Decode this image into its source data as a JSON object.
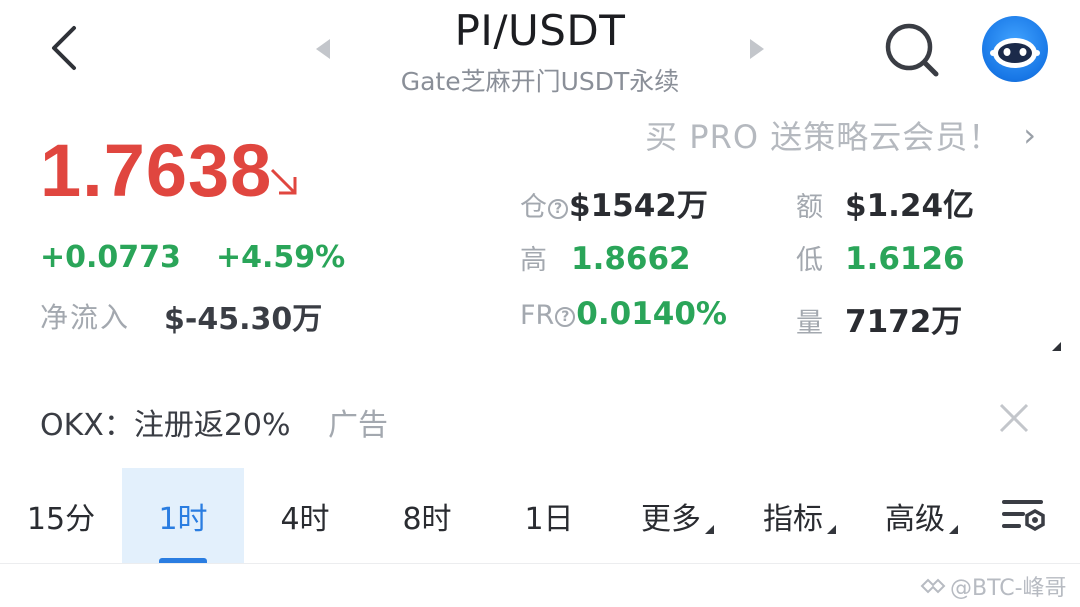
{
  "header": {
    "title": "PI/USDT",
    "subtitle": "Gate芝麻开门USDT永续"
  },
  "promo": {
    "text": "买 PRO 送策略云会员！",
    "chevron": "›"
  },
  "price": {
    "last": "1.7638",
    "change_abs": "+0.0773",
    "change_pct": "+4.59%",
    "netflow_label": "净流入",
    "netflow_value": "$-45.30万"
  },
  "stats": {
    "oi_label": "仓",
    "oi_value": "$1542万",
    "turnover_label": "额",
    "turnover_value": "$1.24亿",
    "high_label": "高",
    "high_value": "1.8662",
    "low_label": "低",
    "low_value": "1.6126",
    "fr_label": "FR",
    "fr_value": "0.0140%",
    "volume_label": "量",
    "volume_value": "7172万",
    "help_glyph": "?"
  },
  "ad": {
    "text": "OKX：注册返20%",
    "tag": "广告"
  },
  "tabs": [
    {
      "label": "15分"
    },
    {
      "label": "1时"
    },
    {
      "label": "4时"
    },
    {
      "label": "8时"
    },
    {
      "label": "1日"
    },
    {
      "label": "更多"
    },
    {
      "label": "指标"
    },
    {
      "label": "高级"
    }
  ],
  "watermark": "@BTC-峰哥",
  "colors": {
    "price_red": "#e0463f",
    "up_green": "#2aa559",
    "accent_blue": "#2a7de1",
    "active_tab_bg": "#e3f0fc"
  },
  "icons": [
    "back-arrow-icon",
    "triangle-left-icon",
    "triangle-right-icon",
    "search-icon",
    "robot-avatar-icon",
    "down-right-arrow-icon",
    "help-circle-icon",
    "close-icon",
    "chart-settings-icon"
  ]
}
